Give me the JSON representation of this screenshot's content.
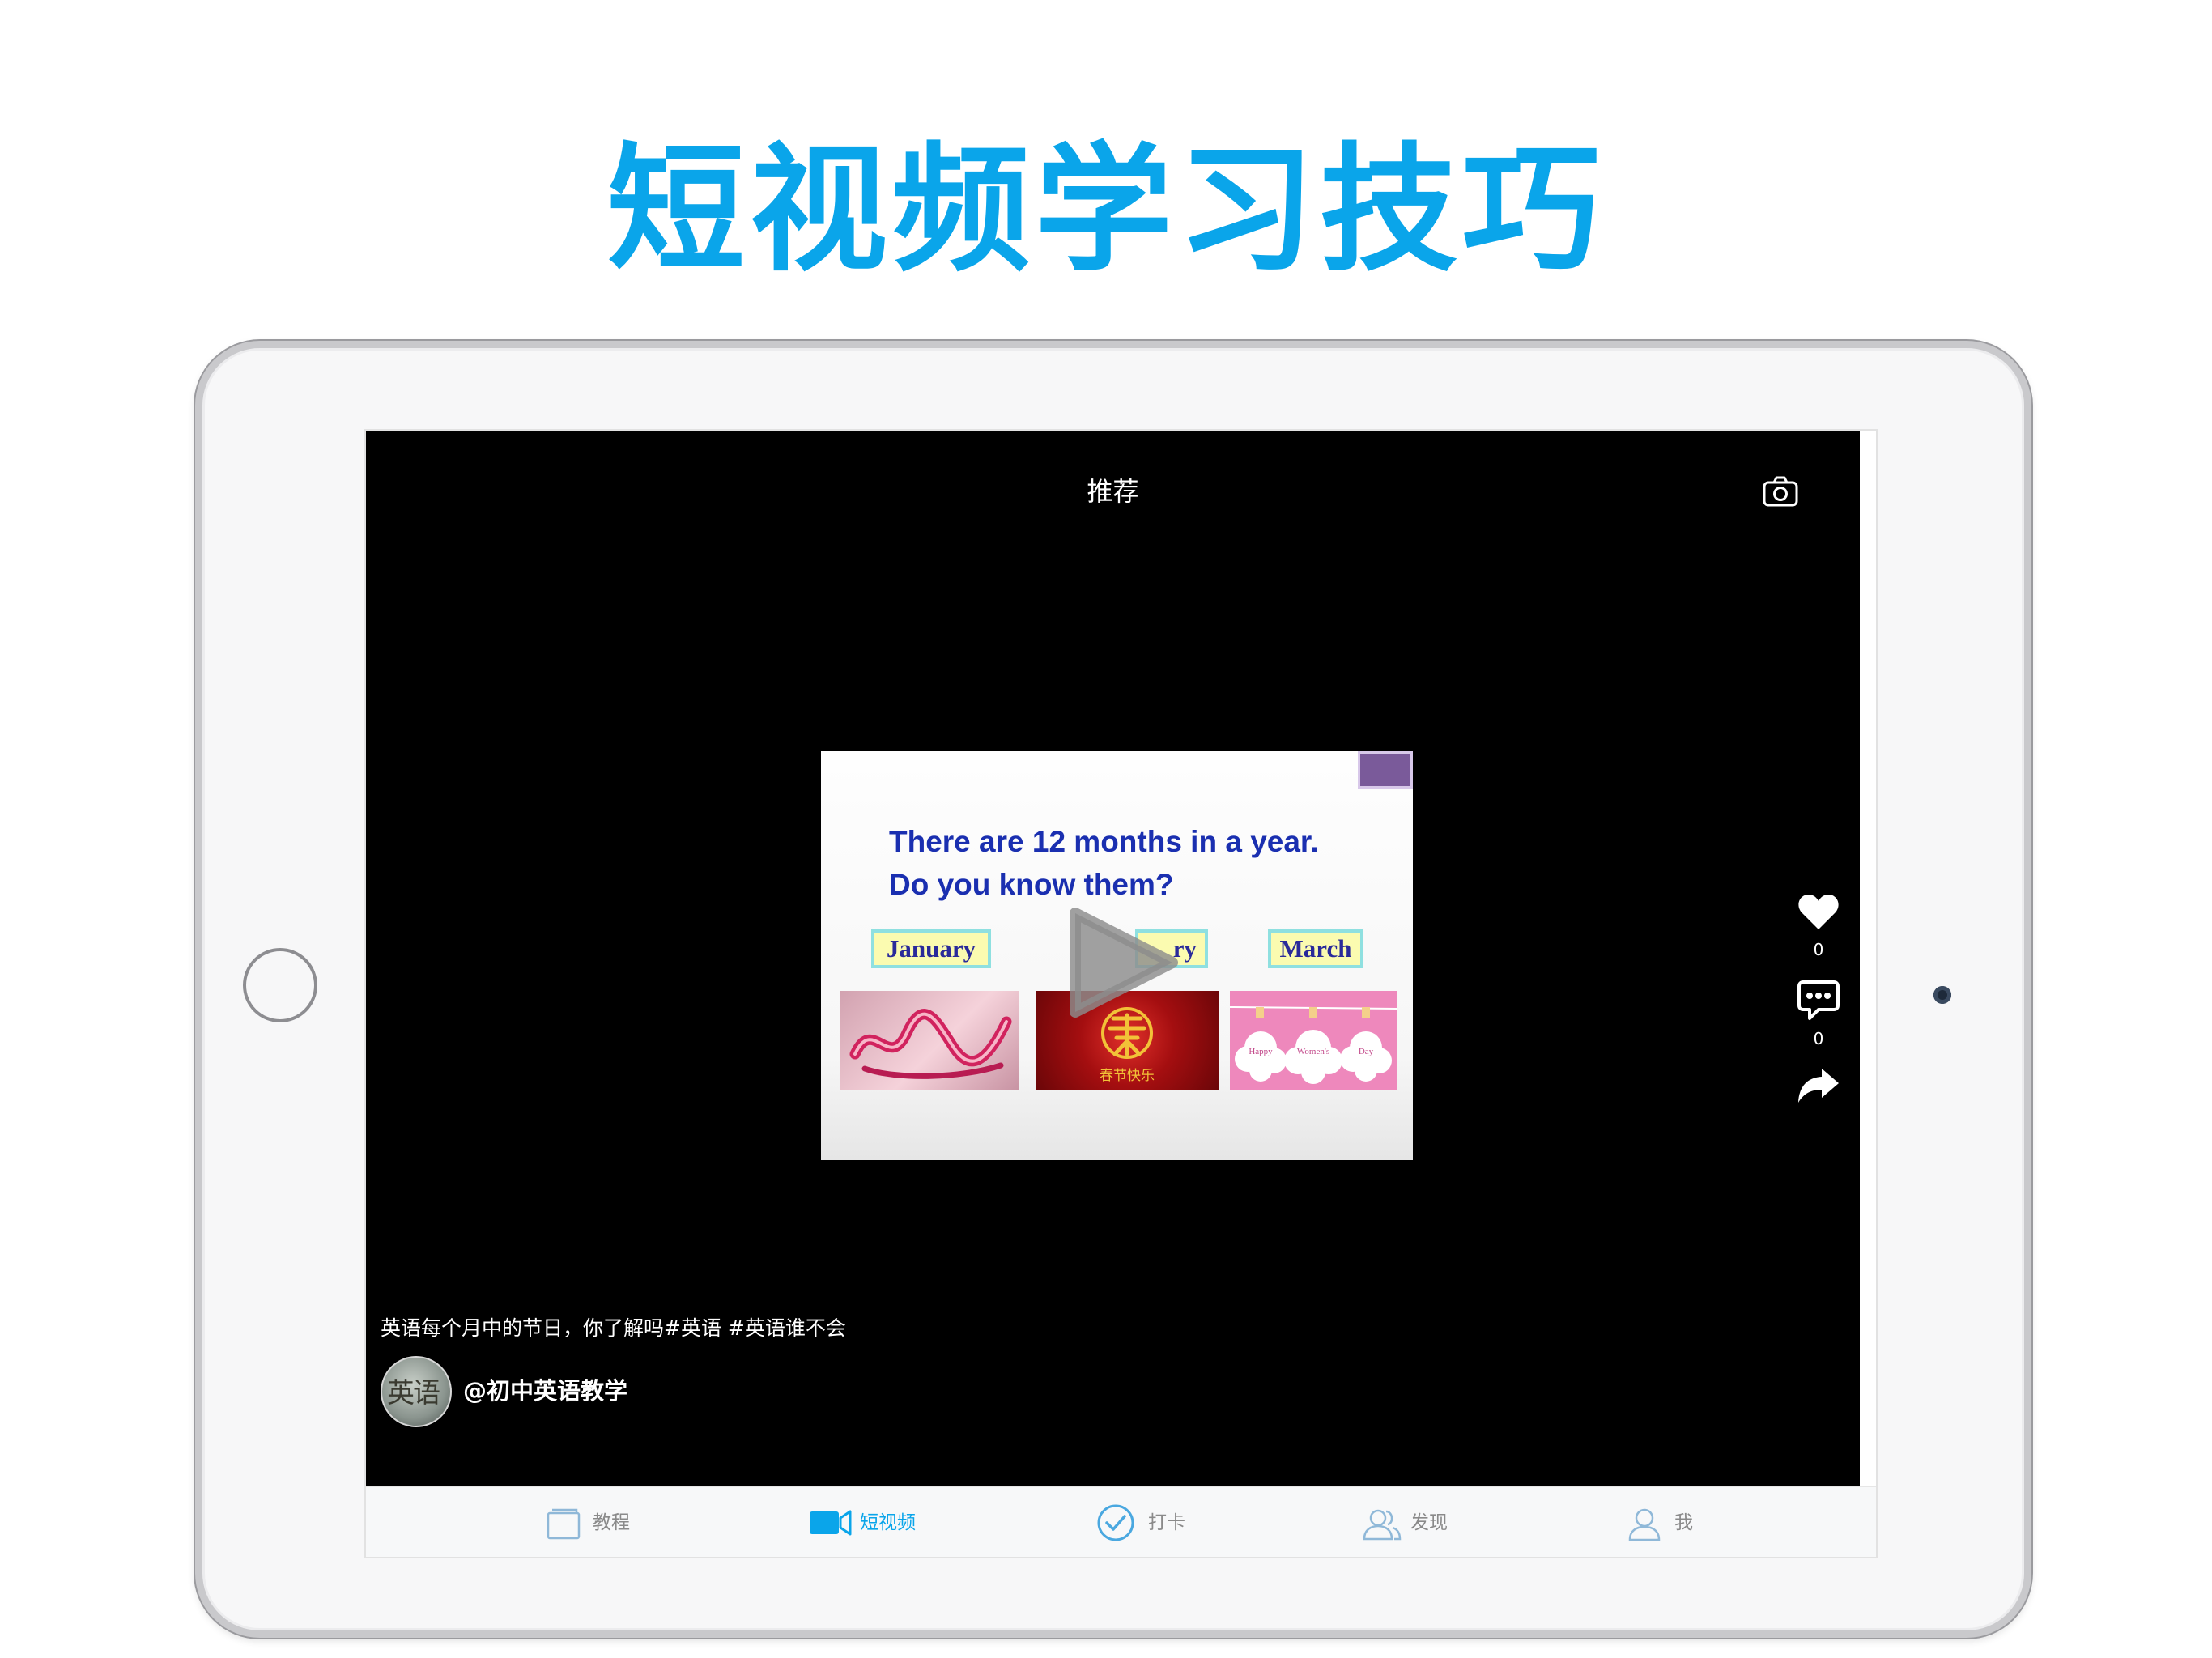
{
  "headline": "短视频学习技巧",
  "header": {
    "title": "推荐"
  },
  "video": {
    "line1": "There are 12 months in a year.",
    "line2": "Do you know them?",
    "months": [
      "January",
      "ry",
      "March"
    ],
    "pic2_text": "春节快乐",
    "pic3_words": [
      "Happy",
      "Women's",
      "Day"
    ]
  },
  "actions": {
    "likes": "0",
    "comments": "0"
  },
  "post": {
    "caption": "英语每个月中的节日，你了解吗#英语 #英语谁不会",
    "author": "@初中英语教学",
    "avatar_text": "英语"
  },
  "tabs": [
    "教程",
    "短视频",
    "打卡",
    "发现",
    "我"
  ],
  "colors": {
    "accent": "#0aa5ea",
    "video_bg": "#000000",
    "tab_inactive": "#8a8a8a"
  }
}
